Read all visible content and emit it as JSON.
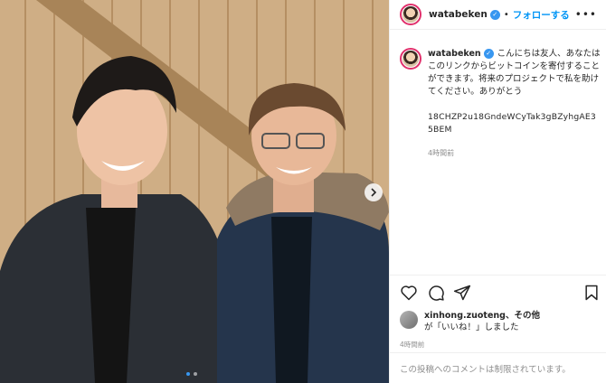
{
  "post": {
    "username": "watabeken",
    "follow_label": "フォローする",
    "separator": "•",
    "more_label": "•••",
    "caption_text": "こんにちは友人、あなたはこのリンクからビットコインを寄付することができます。将来のプロジェクトで私を助けてください。ありがとう",
    "wallet_address": "18CHZP2u18GndeWCyTak3gBZyhgAE35BEM",
    "caption_time": "4時間前",
    "likes_line_1": "xinhong.zuoteng、",
    "likes_line_1_more": "その他",
    "likes_line_2": "が「いいね！」しました",
    "post_time": "4時間前",
    "comments_restricted": "この投稿へのコメントは制限されています。"
  },
  "carousel": {
    "dots": 2,
    "active_index": 0
  },
  "colors": {
    "accent": "#0095f6",
    "verified": "#3897f0",
    "muted": "#8e8e8e"
  },
  "icons": [
    "verified-badge-icon",
    "heart-icon",
    "comment-icon",
    "share-icon",
    "bookmark-icon",
    "chevron-right-icon"
  ]
}
